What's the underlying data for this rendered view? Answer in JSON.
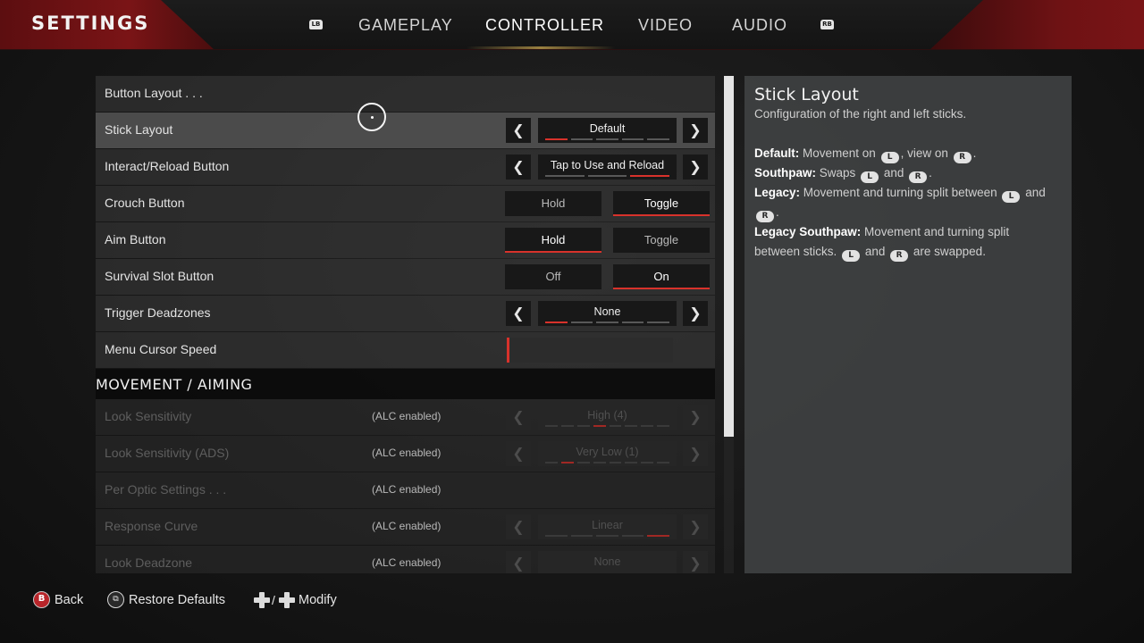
{
  "header": {
    "title": "SETTINGS",
    "left_bumper": "LB",
    "right_bumper": "RB",
    "tabs": [
      {
        "label": "GAMEPLAY",
        "active": false
      },
      {
        "label": "CONTROLLER",
        "active": true
      },
      {
        "label": "VIDEO",
        "active": false
      },
      {
        "label": "AUDIO",
        "active": false
      }
    ]
  },
  "controller": {
    "button_layout": {
      "label": "Button Layout . . ."
    },
    "stick_layout": {
      "label": "Stick Layout",
      "value": "Default",
      "segments": 5,
      "selected_segment": 1
    },
    "interact_reload": {
      "label": "Interact/Reload Button",
      "value": "Tap to Use and Reload",
      "segments": 3,
      "selected_segment": 3
    },
    "crouch": {
      "label": "Crouch Button",
      "option_a": "Hold",
      "option_b": "Toggle",
      "selected": "b"
    },
    "aim": {
      "label": "Aim Button",
      "option_a": "Hold",
      "option_b": "Toggle",
      "selected": "a"
    },
    "survival_slot": {
      "label": "Survival Slot Button",
      "option_a": "Off",
      "option_b": "On",
      "selected": "b"
    },
    "trigger_deadzones": {
      "label": "Trigger Deadzones",
      "value": "None",
      "segments": 5,
      "selected_segment": 1
    },
    "menu_cursor_speed": {
      "label": "Menu Cursor Speed",
      "level": 0.0
    }
  },
  "movement_aiming": {
    "section_title": "MOVEMENT / AIMING",
    "alc_note": "(ALC enabled)",
    "look_sensitivity": {
      "label": "Look Sensitivity",
      "value": "High (4)",
      "segments": 8,
      "selected_segment": 4
    },
    "look_sensitivity_ads": {
      "label": "Look Sensitivity (ADS)",
      "value": "Very Low (1)",
      "segments": 8,
      "selected_segment": 2
    },
    "per_optic": {
      "label": "Per Optic Settings . . ."
    },
    "response_curve": {
      "label": "Response Curve",
      "value": "Linear",
      "segments": 5,
      "selected_segment": 5
    },
    "look_deadzone": {
      "label": "Look Deadzone",
      "value": "None"
    }
  },
  "description": {
    "title": "Stick Layout",
    "subtitle": "Configuration of the right and left sticks.",
    "stick_left": "L",
    "stick_right": "R",
    "default_term": "Default:",
    "default_text_1": "Movement on",
    "default_text_2": ", view on",
    "southpaw_term": "Southpaw:",
    "southpaw_text_1": "Swaps",
    "southpaw_text_2": "and",
    "legacy_term": "Legacy:",
    "legacy_text_1": "Movement and turning split between",
    "legacy_text_2": "and",
    "legacy_southpaw_term": "Legacy Southpaw:",
    "legacy_southpaw_text_1": "Movement and turning split between sticks.",
    "legacy_southpaw_text_2": "and",
    "legacy_southpaw_text_3": "are swapped."
  },
  "footer": {
    "back_glyph": "B",
    "back_label": "Back",
    "restore_label": "Restore Defaults",
    "modify_slash": "/",
    "modify_label": "Modify"
  },
  "colors": {
    "accent_red": "#d8322b",
    "header_red": "#7a1416"
  }
}
